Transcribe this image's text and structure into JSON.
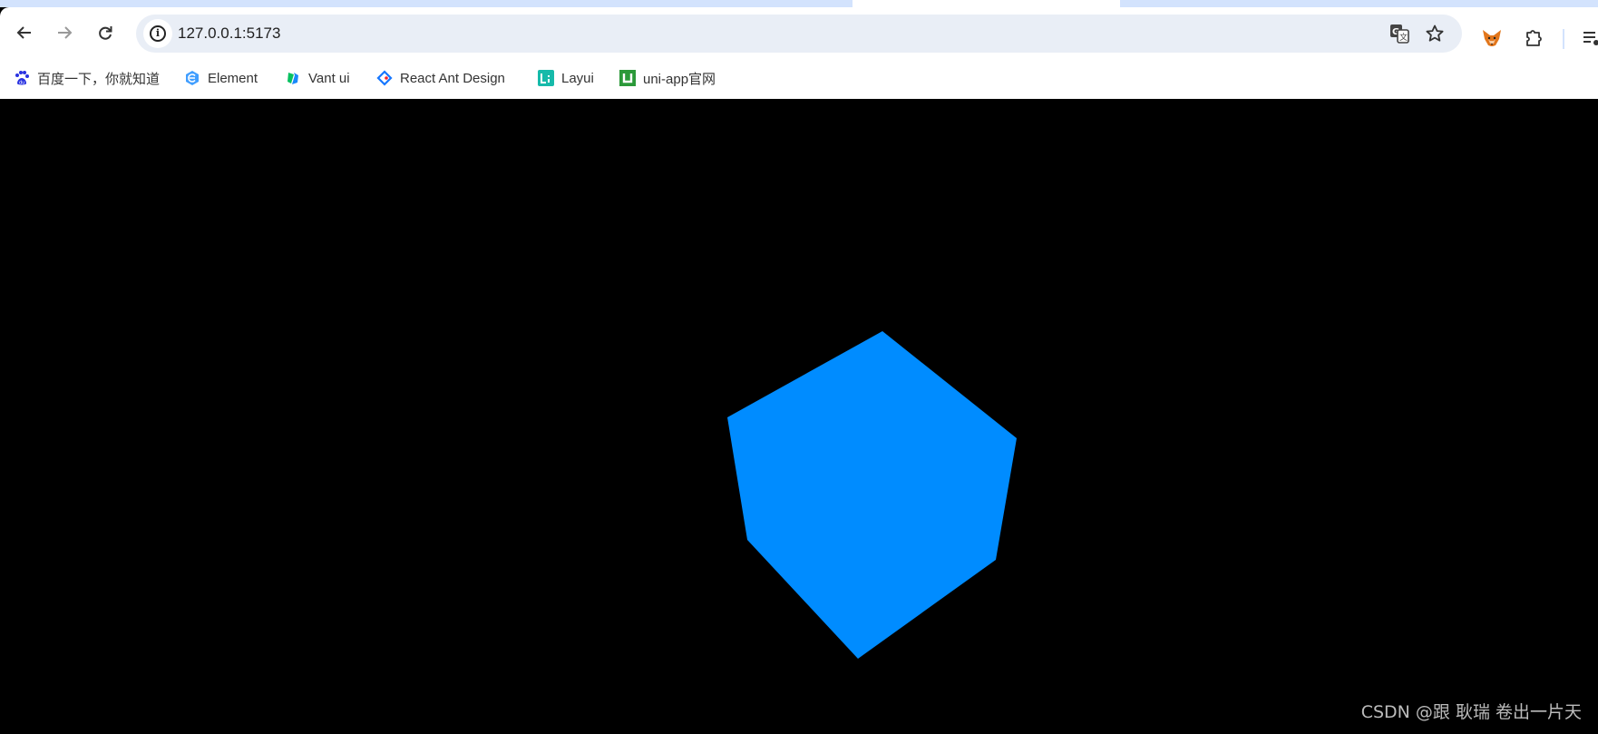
{
  "browser": {
    "url": "127.0.0.1:5173",
    "nav": {
      "back_icon": "arrow-left-icon",
      "forward_icon": "arrow-right-icon",
      "reload_icon": "reload-icon"
    },
    "omnibox_icons": [
      "site-info-icon",
      "translate-icon",
      "star-bookmark-icon"
    ],
    "extensions": [
      "metamask-fox-icon",
      "puzzle-extensions-icon",
      "reading-list-icon"
    ],
    "colors": {
      "tabstrip": "#d3e3fd",
      "omnibox": "#e9eef6"
    }
  },
  "bookmarks": [
    {
      "label": "百度一下，你就知道",
      "icon": "baidu-paw-icon"
    },
    {
      "label": "Element",
      "icon": "element-hex-icon"
    },
    {
      "label": "Vant ui",
      "icon": "vant-icon"
    },
    {
      "label": "React Ant Design",
      "icon": "ant-design-diamond-icon"
    },
    {
      "label": "Layui",
      "icon": "layui-icon"
    },
    {
      "label": "uni-app官网",
      "icon": "uniapp-icon"
    }
  ],
  "scene": {
    "background": "#000000",
    "object": "cube",
    "cube_color": "#008cff"
  },
  "watermark": "CSDN @跟 耿瑞 卷出一片天"
}
